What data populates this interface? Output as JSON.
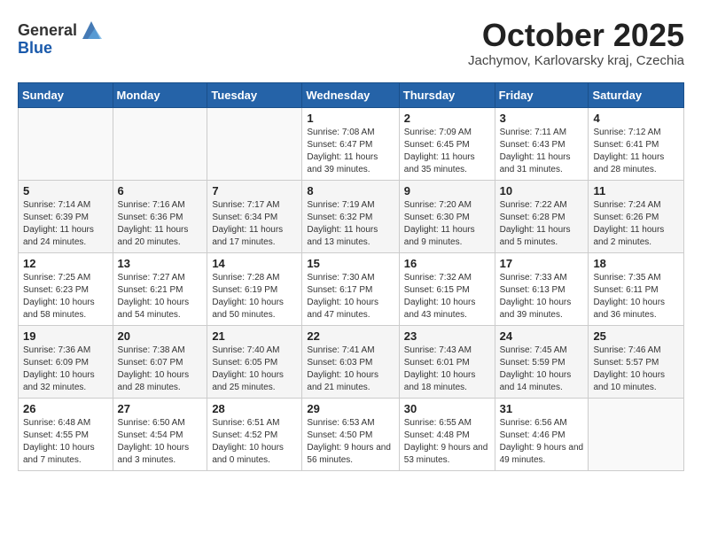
{
  "header": {
    "logo_general": "General",
    "logo_blue": "Blue",
    "month_title": "October 2025",
    "location": "Jachymov, Karlovarsky kraj, Czechia"
  },
  "weekdays": [
    "Sunday",
    "Monday",
    "Tuesday",
    "Wednesday",
    "Thursday",
    "Friday",
    "Saturday"
  ],
  "weeks": [
    [
      {
        "day": "",
        "sunrise": "",
        "sunset": "",
        "daylight": ""
      },
      {
        "day": "",
        "sunrise": "",
        "sunset": "",
        "daylight": ""
      },
      {
        "day": "",
        "sunrise": "",
        "sunset": "",
        "daylight": ""
      },
      {
        "day": "1",
        "sunrise": "Sunrise: 7:08 AM",
        "sunset": "Sunset: 6:47 PM",
        "daylight": "Daylight: 11 hours and 39 minutes."
      },
      {
        "day": "2",
        "sunrise": "Sunrise: 7:09 AM",
        "sunset": "Sunset: 6:45 PM",
        "daylight": "Daylight: 11 hours and 35 minutes."
      },
      {
        "day": "3",
        "sunrise": "Sunrise: 7:11 AM",
        "sunset": "Sunset: 6:43 PM",
        "daylight": "Daylight: 11 hours and 31 minutes."
      },
      {
        "day": "4",
        "sunrise": "Sunrise: 7:12 AM",
        "sunset": "Sunset: 6:41 PM",
        "daylight": "Daylight: 11 hours and 28 minutes."
      }
    ],
    [
      {
        "day": "5",
        "sunrise": "Sunrise: 7:14 AM",
        "sunset": "Sunset: 6:39 PM",
        "daylight": "Daylight: 11 hours and 24 minutes."
      },
      {
        "day": "6",
        "sunrise": "Sunrise: 7:16 AM",
        "sunset": "Sunset: 6:36 PM",
        "daylight": "Daylight: 11 hours and 20 minutes."
      },
      {
        "day": "7",
        "sunrise": "Sunrise: 7:17 AM",
        "sunset": "Sunset: 6:34 PM",
        "daylight": "Daylight: 11 hours and 17 minutes."
      },
      {
        "day": "8",
        "sunrise": "Sunrise: 7:19 AM",
        "sunset": "Sunset: 6:32 PM",
        "daylight": "Daylight: 11 hours and 13 minutes."
      },
      {
        "day": "9",
        "sunrise": "Sunrise: 7:20 AM",
        "sunset": "Sunset: 6:30 PM",
        "daylight": "Daylight: 11 hours and 9 minutes."
      },
      {
        "day": "10",
        "sunrise": "Sunrise: 7:22 AM",
        "sunset": "Sunset: 6:28 PM",
        "daylight": "Daylight: 11 hours and 5 minutes."
      },
      {
        "day": "11",
        "sunrise": "Sunrise: 7:24 AM",
        "sunset": "Sunset: 6:26 PM",
        "daylight": "Daylight: 11 hours and 2 minutes."
      }
    ],
    [
      {
        "day": "12",
        "sunrise": "Sunrise: 7:25 AM",
        "sunset": "Sunset: 6:23 PM",
        "daylight": "Daylight: 10 hours and 58 minutes."
      },
      {
        "day": "13",
        "sunrise": "Sunrise: 7:27 AM",
        "sunset": "Sunset: 6:21 PM",
        "daylight": "Daylight: 10 hours and 54 minutes."
      },
      {
        "day": "14",
        "sunrise": "Sunrise: 7:28 AM",
        "sunset": "Sunset: 6:19 PM",
        "daylight": "Daylight: 10 hours and 50 minutes."
      },
      {
        "day": "15",
        "sunrise": "Sunrise: 7:30 AM",
        "sunset": "Sunset: 6:17 PM",
        "daylight": "Daylight: 10 hours and 47 minutes."
      },
      {
        "day": "16",
        "sunrise": "Sunrise: 7:32 AM",
        "sunset": "Sunset: 6:15 PM",
        "daylight": "Daylight: 10 hours and 43 minutes."
      },
      {
        "day": "17",
        "sunrise": "Sunrise: 7:33 AM",
        "sunset": "Sunset: 6:13 PM",
        "daylight": "Daylight: 10 hours and 39 minutes."
      },
      {
        "day": "18",
        "sunrise": "Sunrise: 7:35 AM",
        "sunset": "Sunset: 6:11 PM",
        "daylight": "Daylight: 10 hours and 36 minutes."
      }
    ],
    [
      {
        "day": "19",
        "sunrise": "Sunrise: 7:36 AM",
        "sunset": "Sunset: 6:09 PM",
        "daylight": "Daylight: 10 hours and 32 minutes."
      },
      {
        "day": "20",
        "sunrise": "Sunrise: 7:38 AM",
        "sunset": "Sunset: 6:07 PM",
        "daylight": "Daylight: 10 hours and 28 minutes."
      },
      {
        "day": "21",
        "sunrise": "Sunrise: 7:40 AM",
        "sunset": "Sunset: 6:05 PM",
        "daylight": "Daylight: 10 hours and 25 minutes."
      },
      {
        "day": "22",
        "sunrise": "Sunrise: 7:41 AM",
        "sunset": "Sunset: 6:03 PM",
        "daylight": "Daylight: 10 hours and 21 minutes."
      },
      {
        "day": "23",
        "sunrise": "Sunrise: 7:43 AM",
        "sunset": "Sunset: 6:01 PM",
        "daylight": "Daylight: 10 hours and 18 minutes."
      },
      {
        "day": "24",
        "sunrise": "Sunrise: 7:45 AM",
        "sunset": "Sunset: 5:59 PM",
        "daylight": "Daylight: 10 hours and 14 minutes."
      },
      {
        "day": "25",
        "sunrise": "Sunrise: 7:46 AM",
        "sunset": "Sunset: 5:57 PM",
        "daylight": "Daylight: 10 hours and 10 minutes."
      }
    ],
    [
      {
        "day": "26",
        "sunrise": "Sunrise: 6:48 AM",
        "sunset": "Sunset: 4:55 PM",
        "daylight": "Daylight: 10 hours and 7 minutes."
      },
      {
        "day": "27",
        "sunrise": "Sunrise: 6:50 AM",
        "sunset": "Sunset: 4:54 PM",
        "daylight": "Daylight: 10 hours and 3 minutes."
      },
      {
        "day": "28",
        "sunrise": "Sunrise: 6:51 AM",
        "sunset": "Sunset: 4:52 PM",
        "daylight": "Daylight: 10 hours and 0 minutes."
      },
      {
        "day": "29",
        "sunrise": "Sunrise: 6:53 AM",
        "sunset": "Sunset: 4:50 PM",
        "daylight": "Daylight: 9 hours and 56 minutes."
      },
      {
        "day": "30",
        "sunrise": "Sunrise: 6:55 AM",
        "sunset": "Sunset: 4:48 PM",
        "daylight": "Daylight: 9 hours and 53 minutes."
      },
      {
        "day": "31",
        "sunrise": "Sunrise: 6:56 AM",
        "sunset": "Sunset: 4:46 PM",
        "daylight": "Daylight: 9 hours and 49 minutes."
      },
      {
        "day": "",
        "sunrise": "",
        "sunset": "",
        "daylight": ""
      }
    ]
  ]
}
